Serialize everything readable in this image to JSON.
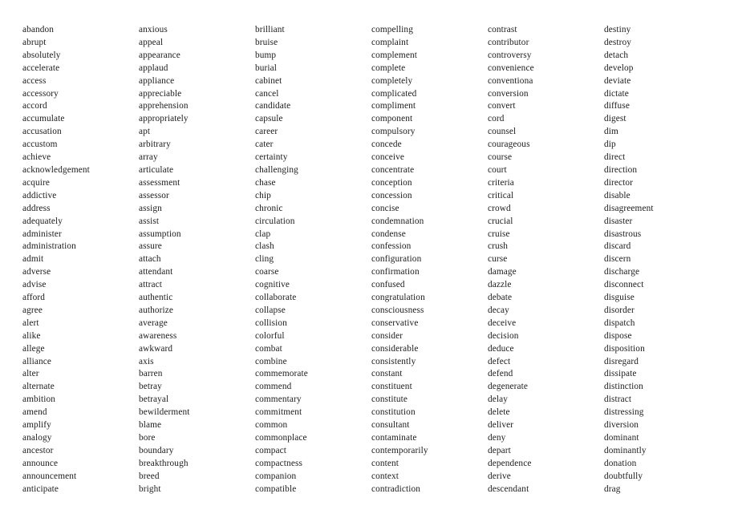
{
  "page": {
    "kind": "word-list-sheet",
    "background_color": "#ffffff",
    "text_color": "#1c1c1c",
    "column_count": 6,
    "rows_per_column": 38
  },
  "columns": [
    {
      "index": 1,
      "words": [
        "abandon",
        "abrupt",
        "absolutely",
        "accelerate",
        "access",
        "accessory",
        "accord",
        "accumulate",
        "accusation",
        "accustom",
        "achieve",
        "acknowledgement",
        "acquire",
        "addictive",
        "address",
        "adequately",
        "administer",
        "administration",
        "admit",
        "adverse",
        "advise",
        "afford",
        "agree",
        "alert",
        "alike",
        "allege",
        "alliance",
        "alter",
        "alternate",
        "ambition",
        "amend",
        "amplify",
        "analogy",
        "ancestor",
        "announce",
        "announcement",
        "anticipate"
      ]
    },
    {
      "index": 2,
      "words": [
        "anxious",
        "appeal",
        "appearance",
        "applaud",
        "appliance",
        "appreciable",
        "apprehension",
        "appropriately",
        "apt",
        "arbitrary",
        "array",
        "articulate",
        "assessment",
        "assessor",
        "assign",
        "assist",
        "assumption",
        "assure",
        "attach",
        "attendant",
        "attract",
        "authentic",
        "authorize",
        "average",
        "awareness",
        "awkward",
        "axis",
        "barren",
        "betray",
        "betrayal",
        "bewilderment",
        "blame",
        "bore",
        "boundary",
        "breakthrough",
        "breed",
        "bright"
      ]
    },
    {
      "index": 3,
      "words": [
        "brilliant",
        "bruise",
        "bump",
        "burial",
        "cabinet",
        "cancel",
        "candidate",
        "capsule",
        "career",
        "cater",
        "certainty",
        "challenging",
        "chase",
        "chip",
        "chronic",
        "circulation",
        "clap",
        "clash",
        "cling",
        "coarse",
        "cognitive",
        "collaborate",
        "collapse",
        "collision",
        "colorful",
        "combat",
        "combine",
        "commemorate",
        "commend",
        "commentary",
        "commitment",
        "common",
        "commonplace",
        "compact",
        "compactness",
        "companion",
        "compatible"
      ]
    },
    {
      "index": 4,
      "words": [
        "compelling",
        "complaint",
        "complement",
        "complete",
        "completely",
        "complicated",
        "compliment",
        "component",
        "compulsory",
        "concede",
        "conceive",
        "concentrate",
        "conception",
        "concession",
        "concise",
        "condemnation",
        "condense",
        "confession",
        "configuration",
        "confirmation",
        "confused",
        "congratulation",
        "consciousness",
        "conservative",
        "consider",
        "considerable",
        "consistently",
        "constant",
        "constituent",
        "constitute",
        "constitution",
        "consultant",
        "contaminate",
        "contemporarily",
        "content",
        "context",
        "contradiction"
      ]
    },
    {
      "index": 5,
      "words": [
        "contrast",
        "contributor",
        "controversy",
        "convenience",
        "conventiona",
        "conversion",
        "convert",
        "cord",
        "counsel",
        "courageous",
        "course",
        "court",
        "criteria",
        "critical",
        "crowd",
        "crucial",
        "cruise",
        "crush",
        "curse",
        "damage",
        "dazzle",
        "debate",
        "decay",
        "deceive",
        "decision",
        "deduce",
        "defect",
        "defend",
        "degenerate",
        "delay",
        "delete",
        "deliver",
        "deny",
        "depart",
        "dependence",
        "derive",
        "descendant"
      ]
    },
    {
      "index": 6,
      "words": [
        "destiny",
        "destroy",
        "detach",
        "develop",
        "deviate",
        "dictate",
        "diffuse",
        "digest",
        "dim",
        "dip",
        "direct",
        "direction",
        "director",
        "disable",
        "disagreement",
        "disaster",
        "disastrous",
        "discard",
        "discern",
        "discharge",
        "disconnect",
        "disguise",
        "disorder",
        "dispatch",
        "dispose",
        "disposition",
        "disregard",
        "dissipate",
        "distinction",
        "distract",
        "distressing",
        "diversion",
        "dominant",
        "dominantly",
        "donation",
        "doubtfully",
        "drag"
      ]
    }
  ]
}
